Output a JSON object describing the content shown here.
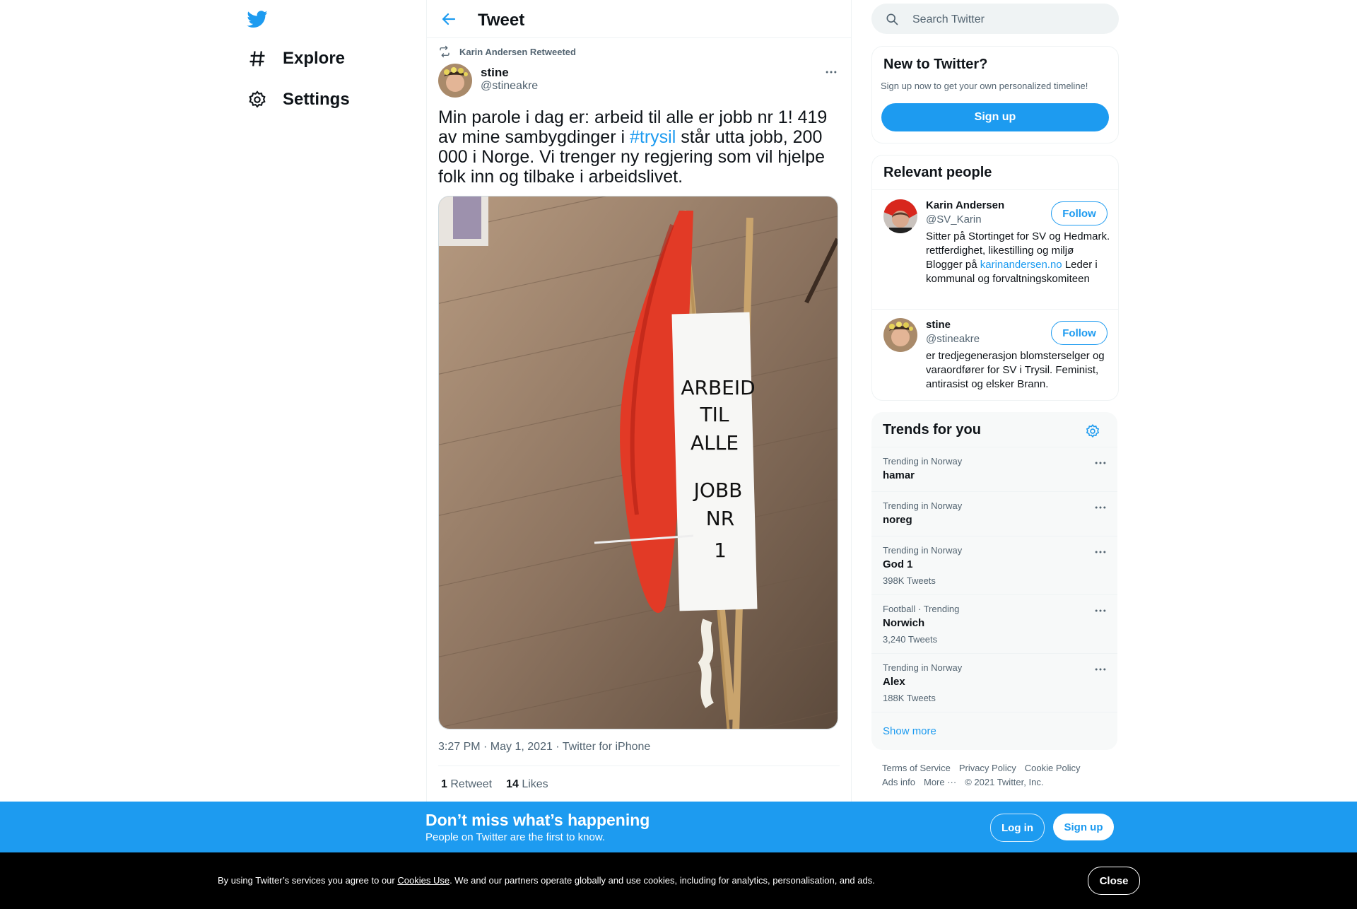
{
  "nav": {
    "items": [
      {
        "label": "Explore",
        "icon": "hashtag-icon"
      },
      {
        "label": "Settings",
        "icon": "gear-icon"
      }
    ]
  },
  "header": {
    "title": "Tweet"
  },
  "tweet": {
    "retweeted_by": "Karin Andersen Retweeted",
    "author_name": "stine",
    "author_handle": "@stineakre",
    "text_before": "Min parole i dag er: arbeid til alle er jobb nr 1! 419 av mine sambygdinger i ",
    "hashtag": "#trysil",
    "text_after": " står utta jobb, 200 000 i Norge. Vi trenger ny regjering som vil hjelpe folk inn og tilbake i arbeidslivet.",
    "photo_note_lines": [
      "ARBEID",
      "TIL",
      "ALLE",
      "JOBB",
      "NR",
      "1"
    ],
    "timestamp": "3:27 PM · May 1, 2021 · Twitter for iPhone",
    "retweet_count": "1",
    "retweet_label": "Retweet",
    "like_count": "14",
    "like_label": "Likes"
  },
  "search": {
    "placeholder": "Search Twitter"
  },
  "new_to_twitter": {
    "title": "New to Twitter?",
    "subtitle": "Sign up now to get your own personalized timeline!",
    "button": "Sign up"
  },
  "relevant_people": {
    "title": "Relevant people",
    "people": [
      {
        "name": "Karin Andersen",
        "handle": "@SV_Karin",
        "bio_before": "Sitter på Stortinget for SV og Hedmark. rettferdighet, likestilling og miljø Blogger på ",
        "bio_link": "karinandersen.no",
        "bio_after": " Leder i kommunal og forvaltningskomiteen",
        "follow": "Follow"
      },
      {
        "name": "stine",
        "handle": "@stineakre",
        "bio": "er tredjegenerasjon blomsterselger og varaordfører for SV i Trysil. Feminist, antirasist og elsker Brann.",
        "follow": "Follow"
      }
    ]
  },
  "trends": {
    "title": "Trends for you",
    "items": [
      {
        "context": "Trending in Norway",
        "name": "hamar",
        "count": ""
      },
      {
        "context": "Trending in Norway",
        "name": "noreg",
        "count": ""
      },
      {
        "context": "Trending in Norway",
        "name": "God 1",
        "count": "398K Tweets"
      },
      {
        "context": "Football · Trending",
        "name": "Norwich",
        "count": "3,240 Tweets"
      },
      {
        "context": "Trending in Norway",
        "name": "Alex",
        "count": "188K Tweets"
      }
    ],
    "show_more": "Show more"
  },
  "footer": {
    "links": [
      "Terms of Service",
      "Privacy Policy",
      "Cookie Policy",
      "Ads info",
      "More ···"
    ],
    "copyright": "© 2021 Twitter, Inc."
  },
  "promo": {
    "title": "Don’t miss what’s happening",
    "subtitle": "People on Twitter are the first to know.",
    "login": "Log in",
    "signup": "Sign up"
  },
  "cookie": {
    "prefix": "By using Twitter’s services you agree to our ",
    "link": "Cookies Use",
    "suffix": ". We and our partners operate globally and use cookies, including for analytics, personalisation, and ads.",
    "close": "Close"
  },
  "colors": {
    "accent": "#1d9bf0",
    "text": "#0f1419",
    "muted": "#536471"
  }
}
